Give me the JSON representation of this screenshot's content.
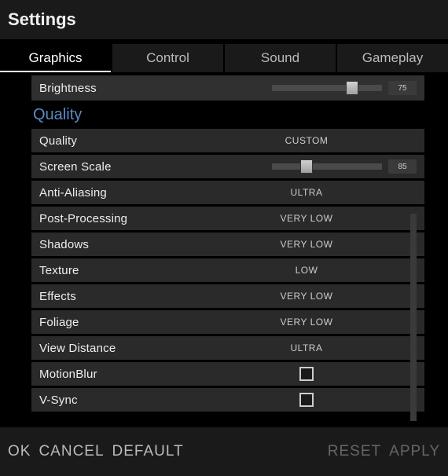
{
  "title": "Settings",
  "tabs": {
    "graphics": "Graphics",
    "control": "Control",
    "sound": "Sound",
    "gameplay": "Gameplay"
  },
  "brightness": {
    "label": "Brightness",
    "value": "75",
    "percent": 67
  },
  "section": "Quality",
  "quality": {
    "label": "Quality",
    "value": "CUSTOM"
  },
  "screenScale": {
    "label": "Screen Scale",
    "value": "85",
    "percent": 26
  },
  "antiAliasing": {
    "label": "Anti-Aliasing",
    "value": "ULTRA"
  },
  "postProcessing": {
    "label": "Post-Processing",
    "value": "VERY LOW"
  },
  "shadows": {
    "label": "Shadows",
    "value": "VERY LOW"
  },
  "texture": {
    "label": "Texture",
    "value": "LOW"
  },
  "effects": {
    "label": "Effects",
    "value": "VERY LOW"
  },
  "foliage": {
    "label": "Foliage",
    "value": "VERY LOW"
  },
  "viewDistance": {
    "label": "View Distance",
    "value": "ULTRA"
  },
  "motionBlur": {
    "label": "MotionBlur"
  },
  "vsync": {
    "label": "V-Sync"
  },
  "footer": {
    "ok": "OK",
    "cancel": "CANCEL",
    "default": "DEFAULT",
    "reset": "RESET",
    "apply": "APPLY"
  }
}
